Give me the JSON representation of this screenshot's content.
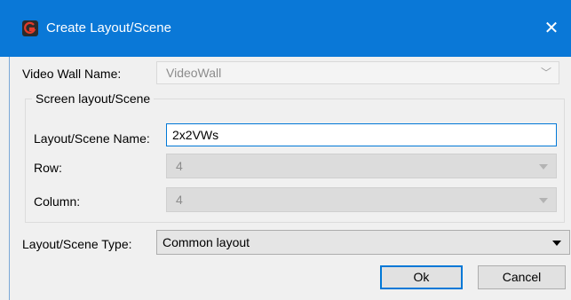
{
  "window": {
    "title": "Create Layout/Scene",
    "close_glyph": "✕",
    "app_icon": "app-logo-icon"
  },
  "video_wall": {
    "label": "Video Wall Name:",
    "value": "VideoWall"
  },
  "screen_group": {
    "title": "Screen layout/Scene",
    "name_label": "Layout/Scene Name:",
    "name_value": "2x2VWs",
    "row_label": "Row:",
    "row_value": "4",
    "column_label": "Column:",
    "column_value": "4"
  },
  "type": {
    "label": "Layout/Scene Type:",
    "value": "Common layout"
  },
  "buttons": {
    "ok": "Ok",
    "cancel": "Cancel"
  },
  "colors": {
    "titlebar": "#0a78d7",
    "focus_border": "#0078d7",
    "background": "#f0f0f0"
  }
}
